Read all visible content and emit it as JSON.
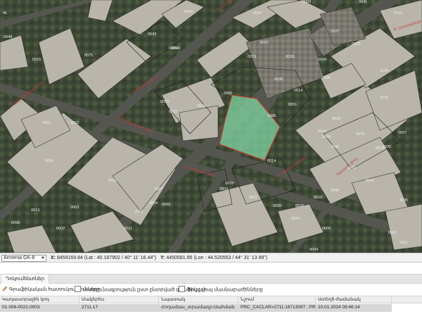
{
  "map": {
    "parcel_labels": [
      "46",
      "0044",
      "0046",
      "0043",
      "0048",
      "0075",
      "0015",
      "0101",
      "0107",
      "0103",
      "0094",
      "0037",
      "0028",
      "0079",
      "0106",
      "0034",
      "0014",
      "0038",
      "0105",
      "0095",
      "0051",
      "0020",
      "0041",
      "0009",
      "0033",
      "0061",
      "0062",
      "0060",
      "0002",
      "0024",
      "0088",
      "0044",
      "0045",
      "0016",
      "0013",
      "0007",
      "0068",
      "0033",
      "0079",
      "0006",
      "0012",
      "0017",
      "0004",
      "0011",
      "0009",
      "0003",
      "0037",
      "0005",
      "0020",
      "0014",
      "0009",
      "0010",
      "0035",
      "0035",
      "0048",
      "0016",
      "0002",
      "0021",
      "0078",
      "0013",
      "0063",
      "0096",
      "0004",
      "0022",
      "0031",
      "0014"
    ],
    "street_labels": [
      "Արշակունյաց փող.",
      "Վ. Պապազյան փող.",
      "Խ. Աբովյան փող.",
      "Ամիրյան փող.",
      "Վ. Սարգսյան փող.",
      "Հ. Հակոբյան փող.",
      "Կասյան փող.",
      "Գ. Լուսավորչի փող."
    ],
    "highlight_color": "#7ecf9e",
    "highlight_border": "#c0392b"
  },
  "coordbar": {
    "projection": "Armenia GK-8",
    "x_label": "X:",
    "x_value": "8459169.84",
    "x_geo": "(Lat : 40.187902 / 40° 11' 16.44\")",
    "y_label": "Y:",
    "y_value": "4450581.95",
    "y_geo": "(Lon : 44.520553 / 44° 31' 13.99\")"
  },
  "panel": {
    "tab_label": "Դոկումենտներ",
    "tool_feature_info": "Գրաֆիկական հատուկությունները",
    "tool_selected_only": "Սատյունագրություն ըստ ընտրված գրաֆիկայի",
    "tool_show_all": "Ցույց տալ մասնաբաժինները",
    "columns": [
      "Կադաստրային կոդ",
      "Մակերես",
      "Նպատակ",
      "Նշում",
      "Ստեղծ ժամանակ"
    ],
    "rows": [
      [
        "01-006-0021-0003",
        "2711.17",
        "Հողամաս_տրամադր.Սահման",
        "PRC_CACLAR=2711.16713097 ; PR...",
        "10.01.2024 09:46:14"
      ]
    ]
  }
}
